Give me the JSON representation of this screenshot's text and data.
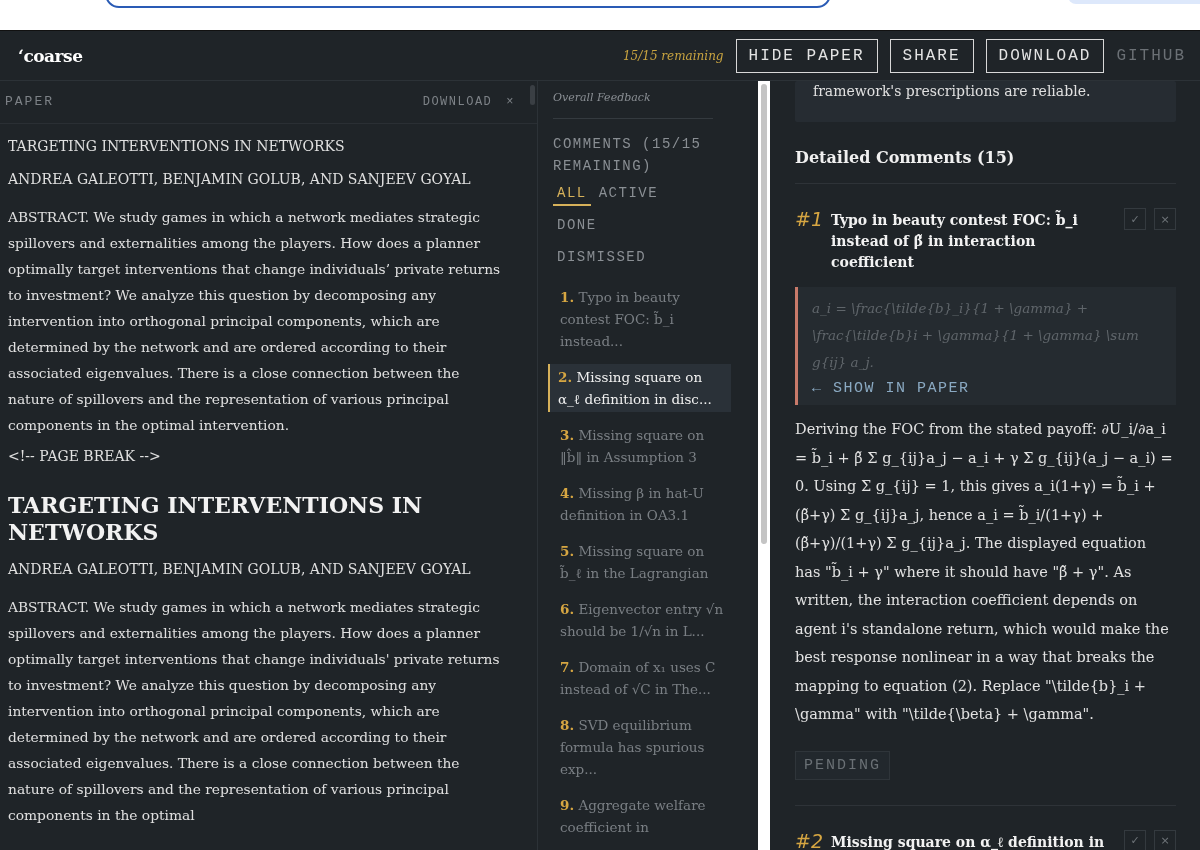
{
  "header": {
    "logo": "‘coarse",
    "remaining": "15/15 remaining",
    "buttons": [
      {
        "label": "HIDE PAPER",
        "kind": "outlined"
      },
      {
        "label": "SHARE",
        "kind": "outlined"
      },
      {
        "label": "DOWNLOAD",
        "kind": "outlined"
      },
      {
        "label": "GITHUB",
        "kind": "plain"
      }
    ]
  },
  "paper": {
    "title": "PAPER",
    "download": "DOWNLOAD",
    "close": "×",
    "blocks": [
      {
        "kind": "text",
        "text": "TARGETING INTERVENTIONS IN NETWORKS"
      },
      {
        "kind": "text",
        "text": "ANDREA GALEOTTI, BENJAMIN GOLUB, AND SANJEEV GOYAL"
      },
      {
        "kind": "para",
        "text": "ABSTRACT. We study games in which a network mediates strategic spillovers and externalities among the players. How does a planner optimally target interventions that change individuals’ private returns to investment? We analyze this question by decomposing any intervention into orthogonal principal components, which are determined by the network and are ordered according to their associated eigenvalues. There is a close connection between the nature of spillovers and the representation of various principal components in the optimal intervention."
      },
      {
        "kind": "text",
        "text": "<!-- PAGE BREAK -->"
      },
      {
        "kind": "heading",
        "text": "TARGETING INTERVENTIONS IN NETWORKS"
      },
      {
        "kind": "text",
        "text": "ANDREA GALEOTTI, BENJAMIN GOLUB, AND SANJEEV GOYAL"
      },
      {
        "kind": "para",
        "text": "ABSTRACT. We study games in which a network mediates strategic spillovers and externalities among the players. How does a planner optimally target interventions that change individuals' private returns to investment? We analyze this question by decomposing any intervention into orthogonal principal components, which are determined by the network and are ordered according to their associated eigenvalues. There is a close connection between the nature of spillovers and the representation of various principal components in the optimal"
      }
    ]
  },
  "sidebar": {
    "overall": "Overall Feedback",
    "heading": "COMMENTS (15/15 REMAINING)",
    "filters": [
      {
        "label": "ALL",
        "selected": true
      },
      {
        "label": "ACTIVE",
        "selected": false
      },
      {
        "label": "DONE",
        "selected": false
      },
      {
        "label": "DISMISSED",
        "selected": false
      }
    ],
    "items": [
      {
        "number": "1.",
        "text": "Typo in beauty contest FOC: b̃_i instead...",
        "selected": false
      },
      {
        "number": "2.",
        "text": "Missing square on α_ℓ definition in disc...",
        "selected": true
      },
      {
        "number": "3.",
        "text": "Missing square on ‖b̂‖ in Assumption 3",
        "selected": false
      },
      {
        "number": "4.",
        "text": "Missing β in hat-U definition in OA3.1",
        "selected": false
      },
      {
        "number": "5.",
        "text": "Missing square on b̃_ℓ in the Lagrangian",
        "selected": false
      },
      {
        "number": "6.",
        "text": "Eigenvector entry √n should be 1/√n in L...",
        "selected": false
      },
      {
        "number": "7.",
        "text": "Domain of x₁ uses C instead of √C in The...",
        "selected": false
      },
      {
        "number": "8.",
        "text": "SVD equilibrium formula has spurious exp...",
        "selected": false
      },
      {
        "number": "9.",
        "text": "Aggregate welfare coefficient in",
        "selected": false
      }
    ]
  },
  "detail": {
    "overall_tail": "framework's prescriptions are reliable.",
    "heading": "Detailed Comments (15)",
    "comments": [
      {
        "number": "#1",
        "title": "Typo in beauty contest FOC: b̃_i instead of β̃ in interaction coefficient",
        "quote": "a_i = \\frac{\\tilde{b}_i}{1 + \\gamma} + \\frac{\\tilde{b}i + \\gamma}{1 + \\gamma} \\sum g{ij} a_j.",
        "show": "← SHOW IN PAPER",
        "body": "Deriving the FOC from the stated payoff: ∂U_i/∂a_i = b̃_i + β̃ Σ g_{ij}a_j − a_i + γ Σ g_{ij}(a_j − a_i) = 0. Using Σ g_{ij} = 1, this gives a_i(1+γ) = b̃_i + (β̃+γ) Σ g_{ij}a_j, hence a_i = b̃_i/(1+γ) + (β̃+γ)/(1+γ) Σ g_{ij}a_j. The displayed equation has \"b̃_i + γ\" where it should have \"β̃ + γ\". As written, the interaction coefficient depends on agent i's standalone return, which would make the best response nonlinear in a way that breaks the mapping to equation (2). Replace \"\\tilde{b}_i + \\gamma\" with \"\\tilde{\\beta} + \\gamma\".",
        "status": "PENDING",
        "accept": "✓",
        "dismiss": "×"
      },
      {
        "number": "#2",
        "title": "Missing square on α_ℓ definition in",
        "accept": "✓",
        "dismiss": "×"
      }
    ]
  }
}
